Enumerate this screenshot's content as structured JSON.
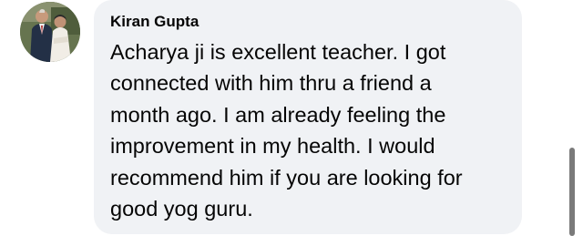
{
  "comment": {
    "author": "Kiran Gupta",
    "text": "Acharya ji is excellent teacher. I got\nconnected with him thru a friend a\nmonth ago. I am already feeling the\nimprovement in my health. I would\nrecommend him if you are looking for\ngood yog guru."
  },
  "colors": {
    "bubble_background": "#f0f2f5",
    "text": "#050505",
    "scrollbar": "#7a7a7a"
  }
}
